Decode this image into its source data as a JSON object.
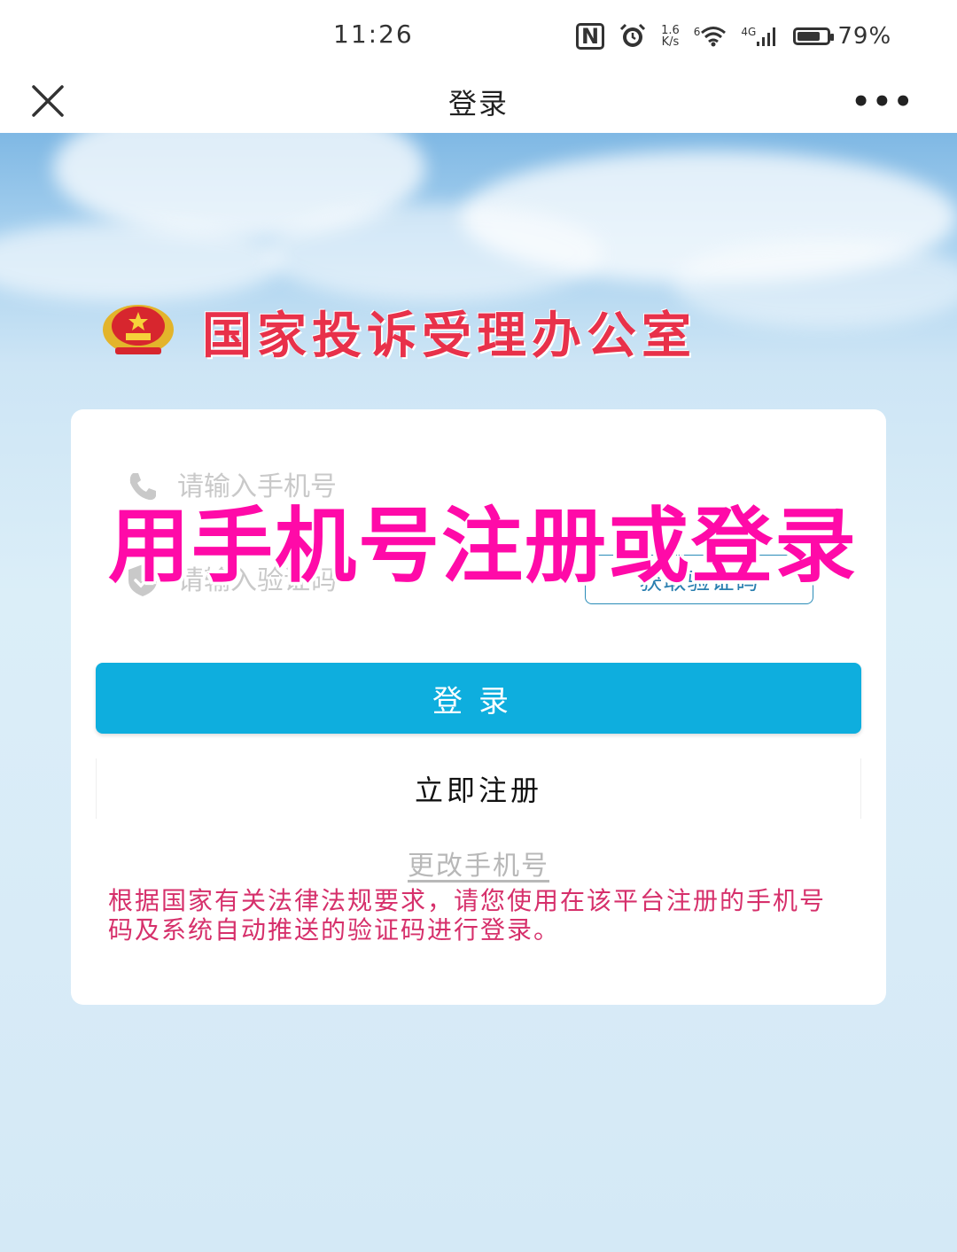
{
  "status_bar": {
    "time": "11:26",
    "nfc_label": "N",
    "net_speed_value": "1.6",
    "net_speed_unit": "K/s",
    "wifi_badge": "6",
    "signal_badge": "4G",
    "battery_percent": "79%",
    "battery_level": 0.79,
    "icons": [
      "nfc-icon",
      "alarm-icon",
      "wifi-icon",
      "signal-icon",
      "battery-icon"
    ]
  },
  "nav": {
    "title": "登录",
    "close_icon": "close-icon",
    "more_label": "•••"
  },
  "header": {
    "org_name": "国家投诉受理办公室",
    "emblem_icon": "national-emblem-icon"
  },
  "form": {
    "phone_placeholder": "请输入手机号",
    "code_placeholder": "请输入验证码",
    "get_code_label": "获取验证码",
    "login_label": "登录",
    "register_label": "立即注册",
    "change_phone_label": "更改手机号",
    "notice": "根据国家有关法律法规要求，请您使用在该平台注册的手机号码及系统自动推送的验证码进行登录。"
  },
  "overlay": {
    "caption": "用手机号注册或登录"
  },
  "colors": {
    "primary_button": "#0eaede",
    "org_title": "#e8314a",
    "notice_text": "#d6306b",
    "overlay_caption": "#ff0aa8"
  }
}
